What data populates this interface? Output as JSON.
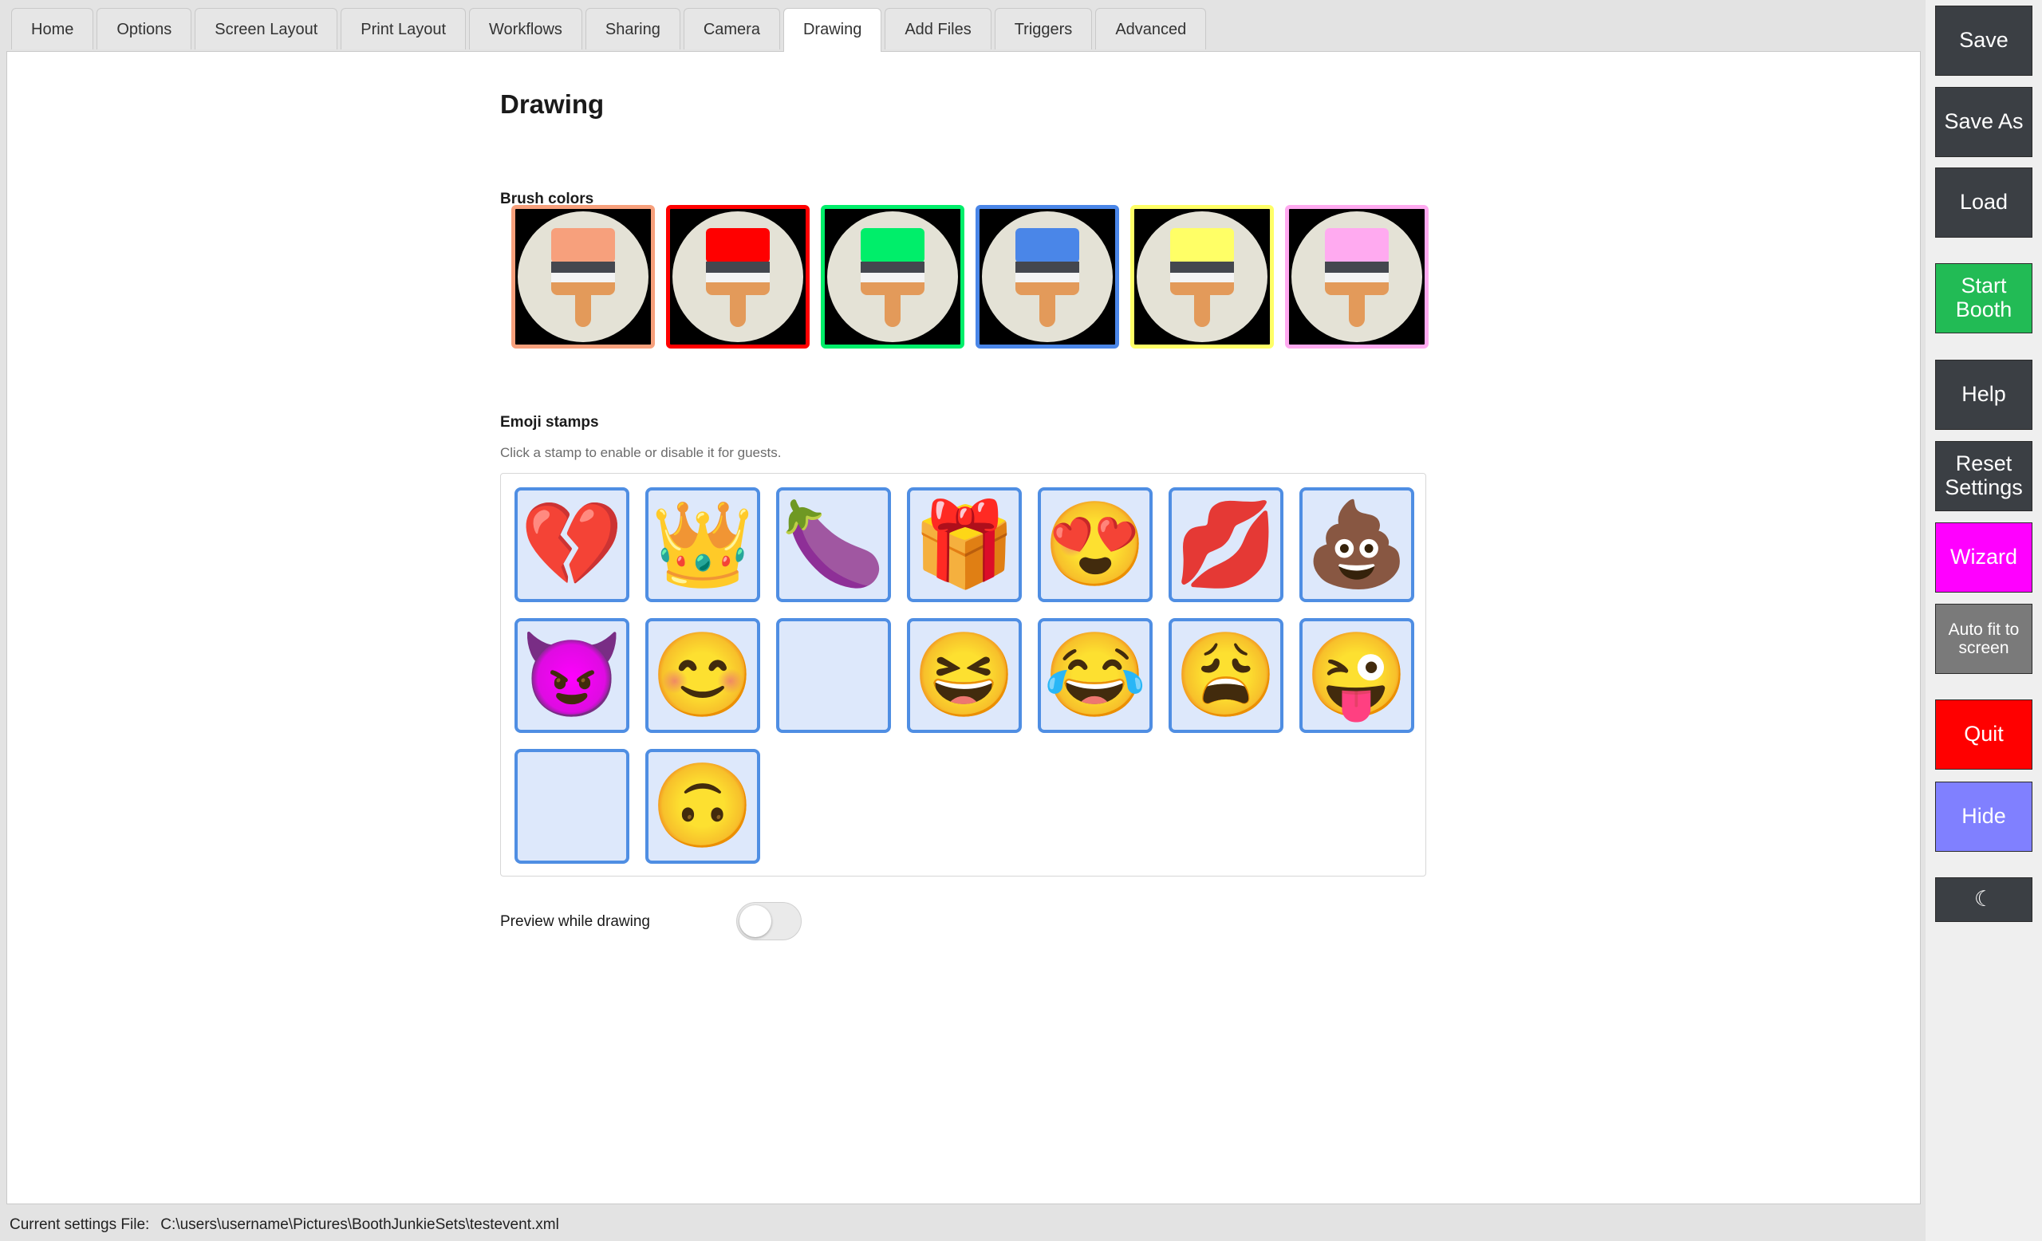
{
  "tabs": [
    "Home",
    "Options",
    "Screen Layout",
    "Print Layout",
    "Workflows",
    "Sharing",
    "Camera",
    "Drawing",
    "Add Files",
    "Triggers",
    "Advanced"
  ],
  "active_tab": "Drawing",
  "page_title": "Drawing",
  "brush_section": {
    "label": "Brush colors",
    "colors": [
      "#f7a07c",
      "#ff0000",
      "#00ee6a",
      "#4a86e8",
      "#ffff66",
      "#ffaaf0"
    ]
  },
  "emoji_section": {
    "label": "Emoji stamps",
    "hint": "Click a stamp to enable or disable it for guests.",
    "stamps": [
      {
        "name": "broken-heart",
        "glyph": "💔"
      },
      {
        "name": "crown",
        "glyph": "👑"
      },
      {
        "name": "eggplant",
        "glyph": "🍆"
      },
      {
        "name": "gift",
        "glyph": "🎁"
      },
      {
        "name": "heart-eyes",
        "glyph": "😍"
      },
      {
        "name": "kiss-mark",
        "glyph": "💋"
      },
      {
        "name": "pile-of-poo",
        "glyph": "💩"
      },
      {
        "name": "smiling-devil",
        "glyph": "😈"
      },
      {
        "name": "smiling-face",
        "glyph": "😊"
      },
      {
        "name": "empty",
        "glyph": ""
      },
      {
        "name": "laughing",
        "glyph": "😆"
      },
      {
        "name": "tears-of-joy",
        "glyph": "😂"
      },
      {
        "name": "weary-face",
        "glyph": "😩"
      },
      {
        "name": "winking-tongue",
        "glyph": "😜"
      },
      {
        "name": "empty",
        "glyph": ""
      },
      {
        "name": "upside-down-face",
        "glyph": "🙃"
      }
    ]
  },
  "preview": {
    "label": "Preview while drawing",
    "enabled": false
  },
  "sidebar": {
    "save": "Save",
    "save_as": "Save As",
    "load": "Load",
    "start_booth": "Start Booth",
    "help": "Help",
    "reset_settings": "Reset Settings",
    "wizard": "Wizard",
    "auto_fit": "Auto fit to screen",
    "quit": "Quit",
    "hide": "Hide",
    "theme_icon": "☾"
  },
  "colors": {
    "start_booth": "#22bb55",
    "wizard": "#ff00ff",
    "auto_fit": "#7a7a7a",
    "quit": "#ff0000",
    "hide": "#8080ff"
  },
  "status": {
    "label": "Current settings File:",
    "path": "C:\\users\\username\\Pictures\\BoothJunkieSets\\testevent.xml"
  }
}
